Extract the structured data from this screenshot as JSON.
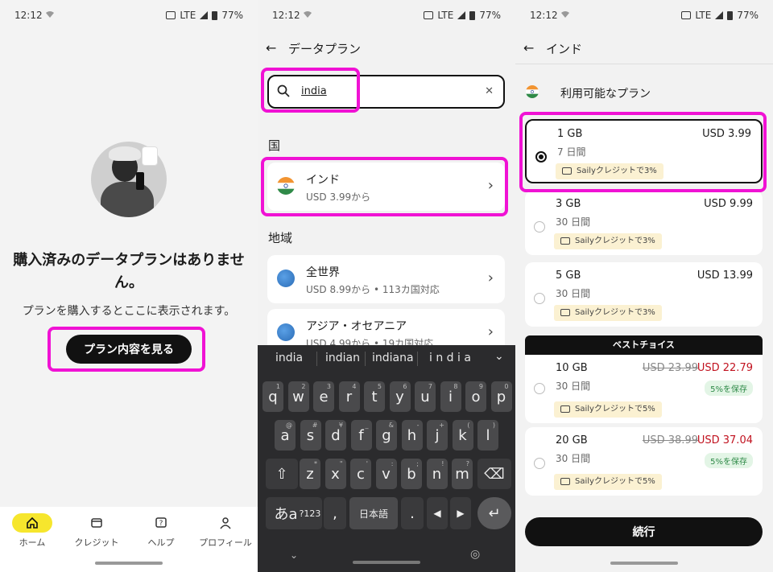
{
  "status": {
    "time": "12:12",
    "network": "LTE",
    "battery": "77%"
  },
  "panel1": {
    "empty_title": "購入済みのデータプランはありません。",
    "empty_sub": "プランを購入するとここに表示されます。",
    "view_plans_label": "プラン内容を見る",
    "nav": [
      {
        "label": "ホーム",
        "icon": "home-icon"
      },
      {
        "label": "クレジット",
        "icon": "wallet-icon"
      },
      {
        "label": "ヘルプ",
        "icon": "help-icon"
      },
      {
        "label": "プロフィール",
        "icon": "person-icon"
      }
    ]
  },
  "panel2": {
    "title": "データプラン",
    "search_value": "india",
    "country_header": "国",
    "country": {
      "name": "インド",
      "price": "USD 3.99から"
    },
    "region_header": "地域",
    "regions": [
      {
        "name": "全世界",
        "price": "USD 8.99から • 113カ国対応"
      },
      {
        "name": "アジア・オセアニア",
        "price": "USD 4.99から • 19カ国対応"
      }
    ],
    "suggestions": [
      "india",
      "indian",
      "indiana",
      "i n d i a"
    ],
    "row1": [
      "q",
      "w",
      "e",
      "r",
      "t",
      "y",
      "u",
      "i",
      "o",
      "p"
    ],
    "row1_sup": [
      "1",
      "2",
      "3",
      "4",
      "5",
      "6",
      "7",
      "8",
      "9",
      "0"
    ],
    "row2": [
      "a",
      "s",
      "d",
      "f",
      "g",
      "h",
      "j",
      "k",
      "l"
    ],
    "row2_sup": [
      "@",
      "#",
      "¥",
      "_",
      "&",
      "-",
      "+",
      "(",
      ")"
    ],
    "row3": [
      "z",
      "x",
      "c",
      "v",
      "b",
      "n",
      "m"
    ],
    "row3_sup": [
      "*",
      "\"",
      "'",
      ":",
      ";",
      "!",
      "?"
    ],
    "key_kana": "あa",
    "key_num": "?123",
    "key_comma": ",",
    "key_lang": "日本語",
    "key_period": "."
  },
  "panel3": {
    "title": "インド",
    "available": "利用可能なプラン",
    "best_choice": "ベストチョイス",
    "continue_label": "続行",
    "plans": [
      {
        "gb": "1 GB",
        "days": "7 日間",
        "price": "USD 3.99",
        "credit": "Sailyクレジットで3%"
      },
      {
        "gb": "3 GB",
        "days": "30 日間",
        "price": "USD 9.99",
        "credit": "Sailyクレジットで3%"
      },
      {
        "gb": "5 GB",
        "days": "30 日間",
        "price": "USD 13.99",
        "credit": "Sailyクレジットで3%"
      },
      {
        "gb": "10 GB",
        "days": "30 日間",
        "old": "USD 23.99",
        "price": "USD 22.79",
        "save": "5%を保存",
        "credit": "Sailyクレジットで5%"
      },
      {
        "gb": "20 GB",
        "days": "30 日間",
        "old": "USD 38.99",
        "price": "USD 37.04",
        "save": "5%を保存",
        "credit": "Sailyクレジットで5%"
      }
    ]
  }
}
